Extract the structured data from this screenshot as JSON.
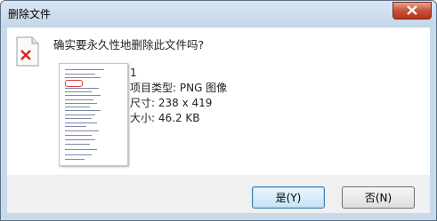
{
  "window": {
    "title": "删除文件"
  },
  "dialog": {
    "question": "确实要永久性地删除此文件吗?",
    "file": {
      "name": "1",
      "type_line": "项目类型: PNG 图像",
      "size_line": "尺寸: 238 x 419",
      "filesize_line": "大小: 46.2 KB"
    }
  },
  "buttons": {
    "yes": "是(Y)",
    "no": "否(N)"
  },
  "icons": {
    "close": "close-icon",
    "file": "delete-file-icon"
  },
  "colors": {
    "close_button": "#c7523b",
    "title_bar": "#c4d6e8",
    "default_button_border": "#3c7fb1"
  }
}
